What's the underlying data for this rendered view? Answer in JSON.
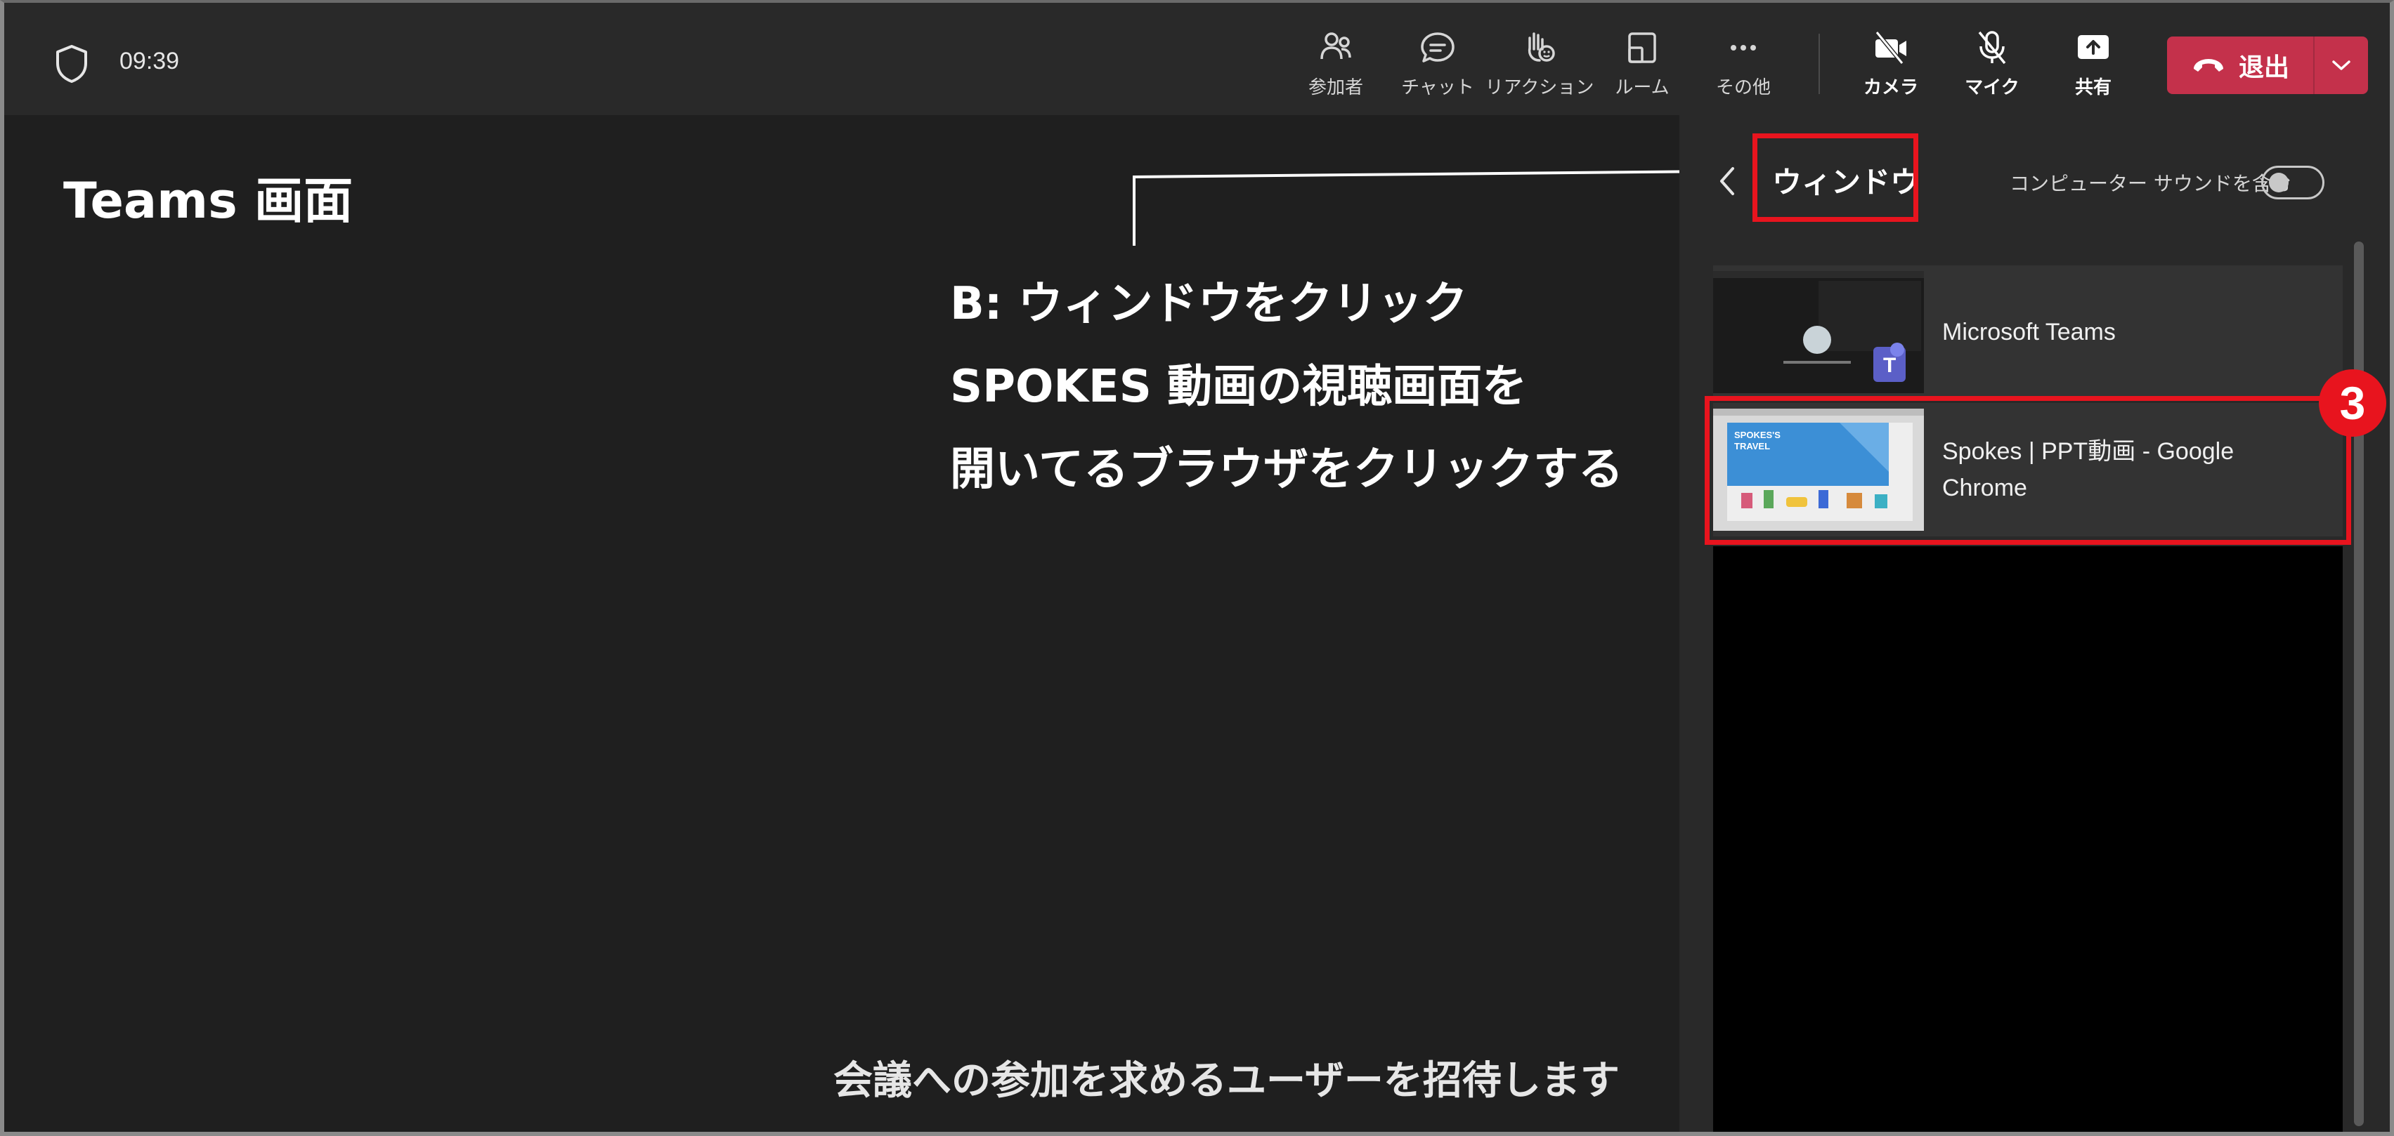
{
  "header": {
    "time": "09:39",
    "buttons": [
      {
        "id": "participants",
        "label": "参加者",
        "icon": "people-icon"
      },
      {
        "id": "chat",
        "label": "チャット",
        "icon": "chat-icon"
      },
      {
        "id": "reactions",
        "label": "リアクション",
        "icon": "raise-hand-icon"
      },
      {
        "id": "rooms",
        "label": "ルーム",
        "icon": "rooms-icon"
      },
      {
        "id": "more",
        "label": "その他",
        "icon": "more-icon"
      },
      {
        "id": "camera",
        "label": "カメラ",
        "icon": "camera-off-icon"
      },
      {
        "id": "mic",
        "label": "マイク",
        "icon": "mic-off-icon"
      },
      {
        "id": "share",
        "label": "共有",
        "icon": "share-icon"
      }
    ],
    "leave_label": "退出"
  },
  "stage": {
    "title": "Teams 画面",
    "callout_lines": [
      "B: ウィンドウをクリック",
      "SPOKES 動画の視聴画面を",
      "開いてるブラウザをクリックする"
    ],
    "invite_text": "会議への参加を求めるユーザーを招待します"
  },
  "panel": {
    "title": "ウィンドウ",
    "sound_label": "コンピューター サウンドを含む",
    "sound_enabled": false,
    "step_badge": "3",
    "windows": [
      {
        "name": "Microsoft Teams",
        "selected": false
      },
      {
        "name": "Spokes | PPT動画 - Google Chrome",
        "selected": true,
        "thumb_text": "SPOKES'S TRAVEL"
      }
    ]
  },
  "colors": {
    "background": "#1f1f1f",
    "topbar": "#292929",
    "leave": "#c4314b",
    "highlight": "#e8141e"
  }
}
